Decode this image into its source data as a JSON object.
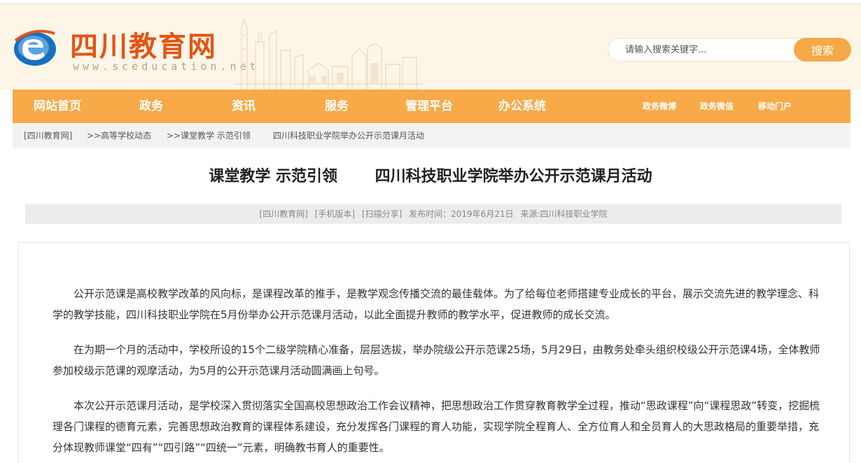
{
  "site": {
    "title": "四川教育网",
    "url": "www.sceducation.net"
  },
  "search": {
    "placeholder": "请输入搜索关键字...",
    "button": "搜索"
  },
  "nav": {
    "items": [
      "网站首页",
      "政务",
      "资讯",
      "服务",
      "管理平台",
      "办公系统"
    ],
    "right": [
      "政务微博",
      "政务微信",
      "移动门户"
    ]
  },
  "breadcrumb": [
    "[四川教育网]",
    ">>高等学校动态",
    ">>课堂教学 示范引领",
    "四川科技职业学院举办公开示范课月活动"
  ],
  "article": {
    "title": "课堂教学 示范引领       四川科技职业学院举办公开示范课月活动",
    "meta": {
      "source_tag": "[四川教育网]",
      "mobile": "[手机版本]",
      "share": "[扫描分享]",
      "published": "发布时间：2019年6月21日",
      "source": "来源:四川科技职业学院"
    },
    "paragraphs": [
      "公开示范课是高校教学改革的风向标，是课程改革的推手，是教学观念传播交流的最佳载体。为了给每位老师搭建专业成长的平台，展示交流先进的教学理念、科学的教学技能，四川科技职业学院在5月份举办公开示范课月活动，以此全面提升教师的教学水平，促进教师的成长交流。",
      "在为期一个月的活动中，学校所设的15个二级学院精心准备，层层选拔，举办院级公开示范课25场，5月29日，由教务处牵头组织校级公开示范课4场，全体教师参加校级示范课的观摩活动，为5月的公开示范课月活动圆满画上句号。",
      "本次公开示范课月活动，是学校深入贯彻落实全国高校思想政治工作会议精神，把思想政治工作贯穿教育教学全过程，推动“思政课程”向“课程思政”转变，挖掘梳理各门课程的德育元素，完善思想政治教育的课程体系建设，充分发挥各门课程的育人功能，实现学院全程育人、全方位育人和全员育人的大思政格局的重要举措，充分体现教师课堂“四有”“四引路”“四统一”元素，明确教书育人的重要性。"
    ]
  },
  "colors": {
    "accent": "#f7aa47",
    "header_bg": "#fdf6e8",
    "logo_text": "#e35514",
    "logo_blue": "#1a6fc0"
  }
}
